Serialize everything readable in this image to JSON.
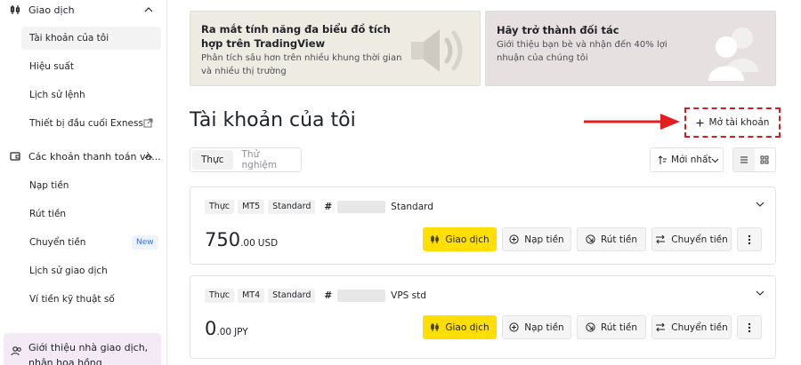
{
  "sidebar": {
    "sections": [
      {
        "label": "Giao dịch",
        "icon": "trading-icon"
      },
      {
        "label": "Các khoản thanh toán và...",
        "icon": "wallet-icon"
      }
    ],
    "trading_items": [
      {
        "label": "Tài khoản của tôi",
        "active": true
      },
      {
        "label": "Hiệu suất"
      },
      {
        "label": "Lịch sử lệnh"
      },
      {
        "label": "Thiết bị đầu cuối Exness",
        "icon": "external-link-icon"
      }
    ],
    "payment_items": [
      {
        "label": "Nạp tiền"
      },
      {
        "label": "Rút tiền"
      },
      {
        "label": "Chuyển tiền",
        "badge": "New"
      },
      {
        "label": "Lịch sử giao dịch"
      },
      {
        "label": "Ví tiền kỹ thuật số"
      }
    ],
    "promo": {
      "label": "Giới thiệu nhà giao dịch, nhận hoa hồng",
      "icon": "users-icon"
    }
  },
  "banners": [
    {
      "title": "Ra mắt tính năng đa biểu đồ tích hợp trên TradingView",
      "description": "Phân tích sâu hơn trên nhiều khung thời gian và nhiều thị trường",
      "art": "speaker-icon",
      "background": "#eeebe3"
    },
    {
      "title": "Hãy trở thành đối tác",
      "description": "Giới thiệu bạn bè và nhận đến 40% lợi nhuận của chúng tôi",
      "art": "people-icon",
      "background": "#e6e0e0"
    }
  ],
  "main": {
    "title": "Tài khoản của tôi",
    "open_account_label": "Mở tài khoản",
    "tabs": [
      {
        "label": "Thực",
        "active": true
      },
      {
        "label": "Thử nghiệm",
        "active": false
      }
    ],
    "sort_label": "Mới nhất",
    "accent_color": "#ffde02",
    "annotation_color": "#d11f1f"
  },
  "accounts": [
    {
      "tags": [
        "Thực",
        "MT5",
        "Standard"
      ],
      "hash": "#",
      "name": "Standard",
      "balance_int": "750",
      "balance_dec": ".00",
      "currency": "USD"
    },
    {
      "tags": [
        "Thực",
        "MT4",
        "Standard"
      ],
      "hash": "#",
      "name": "VPS std",
      "balance_int": "0",
      "balance_dec": ".00",
      "currency": "JPY"
    }
  ],
  "actions": {
    "trade": "Giao dịch",
    "deposit": "Nạp tiền",
    "withdraw": "Rút tiền",
    "transfer": "Chuyển tiền"
  }
}
